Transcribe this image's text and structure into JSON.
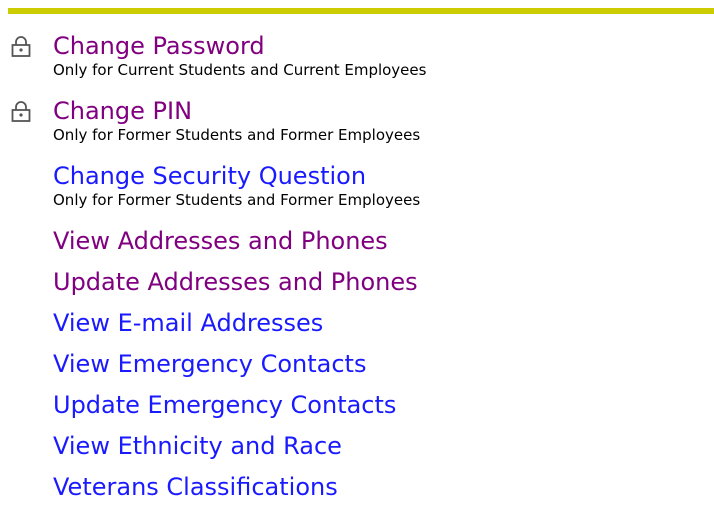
{
  "accent_color": "#cccc00",
  "menu": {
    "items": [
      {
        "label": "Change Password",
        "description": "Only for Current Students and Current Employees",
        "icon": "lock-icon",
        "state": "visited"
      },
      {
        "label": "Change PIN",
        "description": "Only for Former Students and Former Employees",
        "icon": "lock-icon",
        "state": "visited"
      },
      {
        "label": "Change Security Question",
        "description": "Only for Former Students and Former Employees",
        "state": "unvisited"
      },
      {
        "label": "View Addresses and Phones",
        "state": "visited"
      },
      {
        "label": "Update Addresses and Phones",
        "state": "visited"
      },
      {
        "label": "View E-mail Addresses",
        "state": "unvisited"
      },
      {
        "label": "View Emergency Contacts",
        "state": "unvisited"
      },
      {
        "label": "Update Emergency Contacts",
        "state": "unvisited"
      },
      {
        "label": "View Ethnicity and Race",
        "state": "unvisited"
      },
      {
        "label": "Veterans Classifications",
        "state": "unvisited"
      }
    ]
  }
}
